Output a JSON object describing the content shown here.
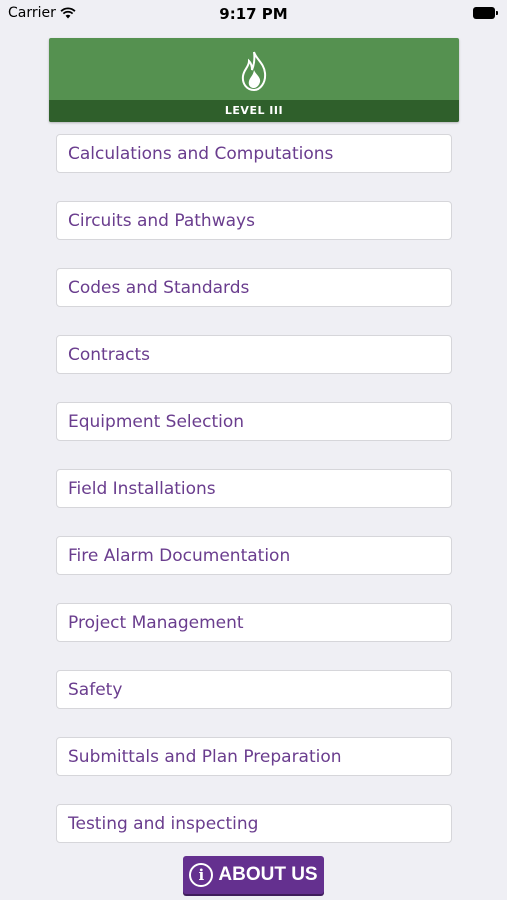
{
  "status_bar": {
    "carrier": "Carrier",
    "time": "9:17 PM"
  },
  "header": {
    "logo_icon": "flame-icon",
    "level_label": "LEVEL III",
    "colors": {
      "banner": "#559150",
      "level_bar": "#2f5f2b"
    }
  },
  "menu": {
    "items": [
      {
        "label": "Calculations and Computations"
      },
      {
        "label": "Circuits and Pathways"
      },
      {
        "label": "Codes and Standards"
      },
      {
        "label": "Contracts"
      },
      {
        "label": "Equipment Selection"
      },
      {
        "label": "Field Installations"
      },
      {
        "label": "Fire Alarm Documentation"
      },
      {
        "label": "Project Management"
      },
      {
        "label": "Safety"
      },
      {
        "label": "Submittals and Plan Preparation"
      },
      {
        "label": "Testing and inspecting"
      }
    ],
    "text_color": "#6a3d8e"
  },
  "about": {
    "icon": "info-icon",
    "icon_glyph": "i",
    "label": "ABOUT US",
    "color": "#64308f"
  }
}
